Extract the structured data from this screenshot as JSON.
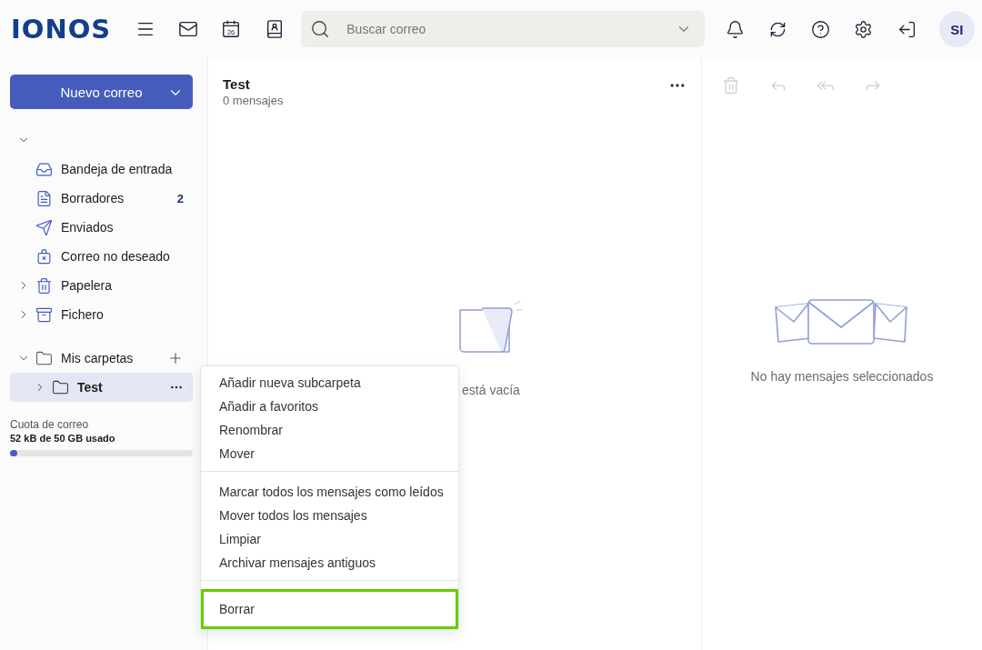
{
  "header": {
    "logo": "IONOS",
    "calendar_day": "26",
    "search": {
      "placeholder": "Buscar correo"
    },
    "avatar": "SI"
  },
  "sidebar": {
    "new_mail_button": "Nuevo correo",
    "account": {
      "expanded": true
    },
    "folders": [
      {
        "kind": "inbox",
        "label": "Bandeja de entrada"
      },
      {
        "kind": "drafts",
        "label": "Borradores",
        "count": "2"
      },
      {
        "kind": "sent",
        "label": "Enviados"
      },
      {
        "kind": "spam",
        "label": "Correo no deseado"
      },
      {
        "kind": "trash",
        "label": "Papelera",
        "expanded": false
      },
      {
        "kind": "archive",
        "label": "Fichero",
        "expanded": false
      }
    ],
    "my_folders": {
      "label": "Mis carpetas",
      "expanded": true,
      "items": [
        {
          "label": "Test",
          "selected": true,
          "expanded": false
        }
      ]
    },
    "quota": {
      "title": "Cuota de correo",
      "usage": "52 kB de 50 GB usado",
      "level": 0.04
    }
  },
  "message_list": {
    "title": "Test",
    "subtitle": "0 mensajes",
    "empty_text": "está vacía"
  },
  "reading_pane": {
    "empty_text": "No hay mensajes seleccionados"
  },
  "context_menu": {
    "sections": [
      [
        {
          "label": "Añadir nueva subcarpeta",
          "highlighted": false
        },
        {
          "label": "Añadir a favoritos",
          "highlighted": false
        },
        {
          "label": "Renombrar",
          "highlighted": false
        },
        {
          "label": "Mover",
          "highlighted": false
        }
      ],
      [
        {
          "label": "Marcar todos los mensajes como leídos",
          "highlighted": false
        },
        {
          "label": "Mover todos los mensajes",
          "highlighted": false
        },
        {
          "label": "Limpiar",
          "highlighted": false
        },
        {
          "label": "Archivar mensajes antiguos",
          "highlighted": false
        }
      ],
      [
        {
          "label": "Borrar",
          "highlighted": true
        }
      ]
    ]
  }
}
